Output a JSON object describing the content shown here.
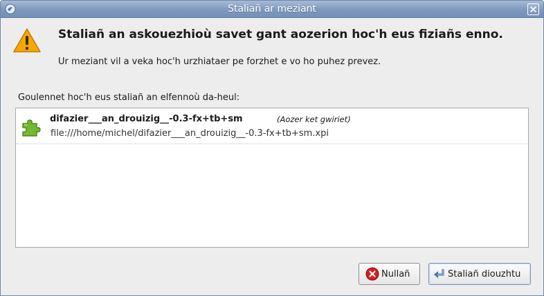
{
  "window": {
    "title": "Staliañ ar meziant"
  },
  "dialog": {
    "heading": "Staliañ an askouezhioù savet gant aozerion hoc'h eus fiziañs enno.",
    "subtext": "Ur meziant vil a veka hoc'h urzhiataer pe forzhet e vo ho puhez prevez.",
    "list_label": "Goulennet hoc'h eus staliañ an elfennoù da-heul:"
  },
  "addons": [
    {
      "name": "difazier___an_drouizig__-0.3-fx+tb+sm",
      "note": "(Aozer ket gwiriet)",
      "url": "file:///home/michel/difazier___an_drouizig__-0.3-fx+tb+sm.xpi",
      "icon": "puzzle-icon"
    }
  ],
  "buttons": {
    "cancel_label": "Nullañ",
    "install_label": "Staliañ diouzhtu"
  },
  "colors": {
    "titlebar": "#7f98bc",
    "warning": "#f5a800",
    "cancel_icon": "#d42020",
    "addon_icon": "#73b830"
  }
}
